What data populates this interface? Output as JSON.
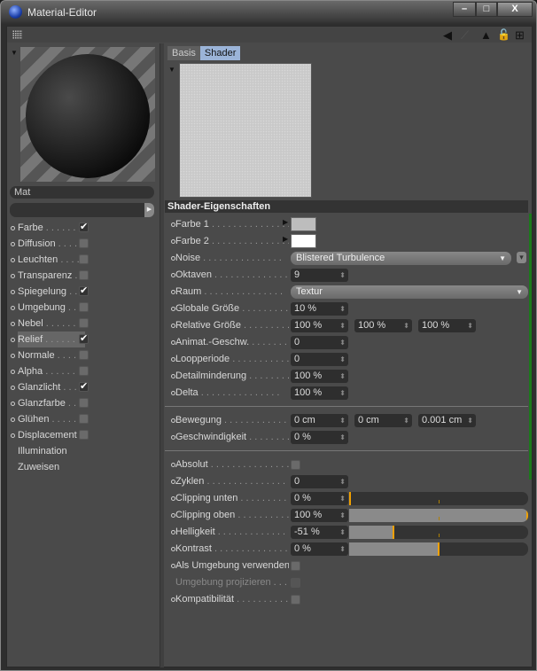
{
  "window": {
    "title": "Material-Editor",
    "minimize": "–",
    "maximize": "□",
    "close": "X"
  },
  "toolbar": {
    "back": "◀",
    "forward": "⟋",
    "up": "▲",
    "lock": "🔓",
    "new": "⊞"
  },
  "material": {
    "name": "Mat"
  },
  "channels": [
    {
      "label": "Farbe",
      "checked": true
    },
    {
      "label": "Diffusion",
      "checked": false
    },
    {
      "label": "Leuchten",
      "checked": false
    },
    {
      "label": "Transparenz",
      "checked": false
    },
    {
      "label": "Spiegelung",
      "checked": true
    },
    {
      "label": "Umgebung",
      "checked": false
    },
    {
      "label": "Nebel",
      "checked": false
    },
    {
      "label": "Relief",
      "checked": true,
      "selected": true
    },
    {
      "label": "Normale",
      "checked": false
    },
    {
      "label": "Alpha",
      "checked": false
    },
    {
      "label": "Glanzlicht",
      "checked": true
    },
    {
      "label": "Glanzfarbe",
      "checked": false
    },
    {
      "label": "Glühen",
      "checked": false
    },
    {
      "label": "Displacement",
      "checked": false
    }
  ],
  "extra_items": [
    "Illumination",
    "Zuweisen"
  ],
  "tabs": [
    {
      "label": "Basis",
      "active": false
    },
    {
      "label": "Shader",
      "active": true
    }
  ],
  "section_title": "Shader-Eigenschaften",
  "props": [
    {
      "label": "Farbe 1",
      "type": "color",
      "color": "#bdbdbd"
    },
    {
      "label": "Farbe 2",
      "type": "color",
      "color": "#ffffff"
    },
    {
      "label": "Noise",
      "type": "dropdown",
      "value": "Blistered Turbulence",
      "extra": true
    },
    {
      "label": "Oktaven",
      "type": "num",
      "values": [
        "9"
      ]
    },
    {
      "label": "Raum",
      "type": "dropdown",
      "value": "Textur"
    },
    {
      "label": "Globale Größe",
      "type": "num",
      "values": [
        "10 %"
      ]
    },
    {
      "label": "Relative Größe",
      "type": "num",
      "values": [
        "100 %",
        "100 %",
        "100 %"
      ]
    },
    {
      "label": "Animat.-Geschw.",
      "type": "num",
      "values": [
        "0"
      ]
    },
    {
      "label": "Loopperiode",
      "type": "num",
      "values": [
        "0"
      ]
    },
    {
      "label": "Detailminderung",
      "type": "num",
      "values": [
        "100 %"
      ]
    },
    {
      "label": "Delta",
      "type": "num",
      "values": [
        "100 %"
      ]
    },
    {
      "type": "sep"
    },
    {
      "label": "Bewegung",
      "type": "num",
      "values": [
        "0 cm",
        "0 cm",
        "0.001 cm"
      ]
    },
    {
      "label": "Geschwindigkeit",
      "type": "num",
      "values": [
        "0 %"
      ]
    },
    {
      "type": "sep"
    },
    {
      "label": "Absolut",
      "type": "check",
      "checked": false
    },
    {
      "label": "Zyklen",
      "type": "num",
      "values": [
        "0"
      ]
    },
    {
      "label": "Clipping unten",
      "type": "slider",
      "values": [
        "0 %"
      ],
      "fraction": 0.0
    },
    {
      "label": "Clipping oben",
      "type": "slider",
      "values": [
        "100 %"
      ],
      "fraction": 1.0
    },
    {
      "label": "Helligkeit",
      "type": "slider",
      "values": [
        "-51 %"
      ],
      "fraction": 0.245
    },
    {
      "label": "Kontrast",
      "type": "slider",
      "values": [
        "0 %"
      ],
      "fraction": 0.5
    },
    {
      "label": "Als Umgebung verwenden",
      "type": "check",
      "checked": false,
      "nodots": true
    },
    {
      "label": "Umgebung projizieren",
      "type": "check",
      "checked": false,
      "disabled": true
    },
    {
      "label": "Kompatibilität",
      "type": "check",
      "checked": false
    }
  ]
}
